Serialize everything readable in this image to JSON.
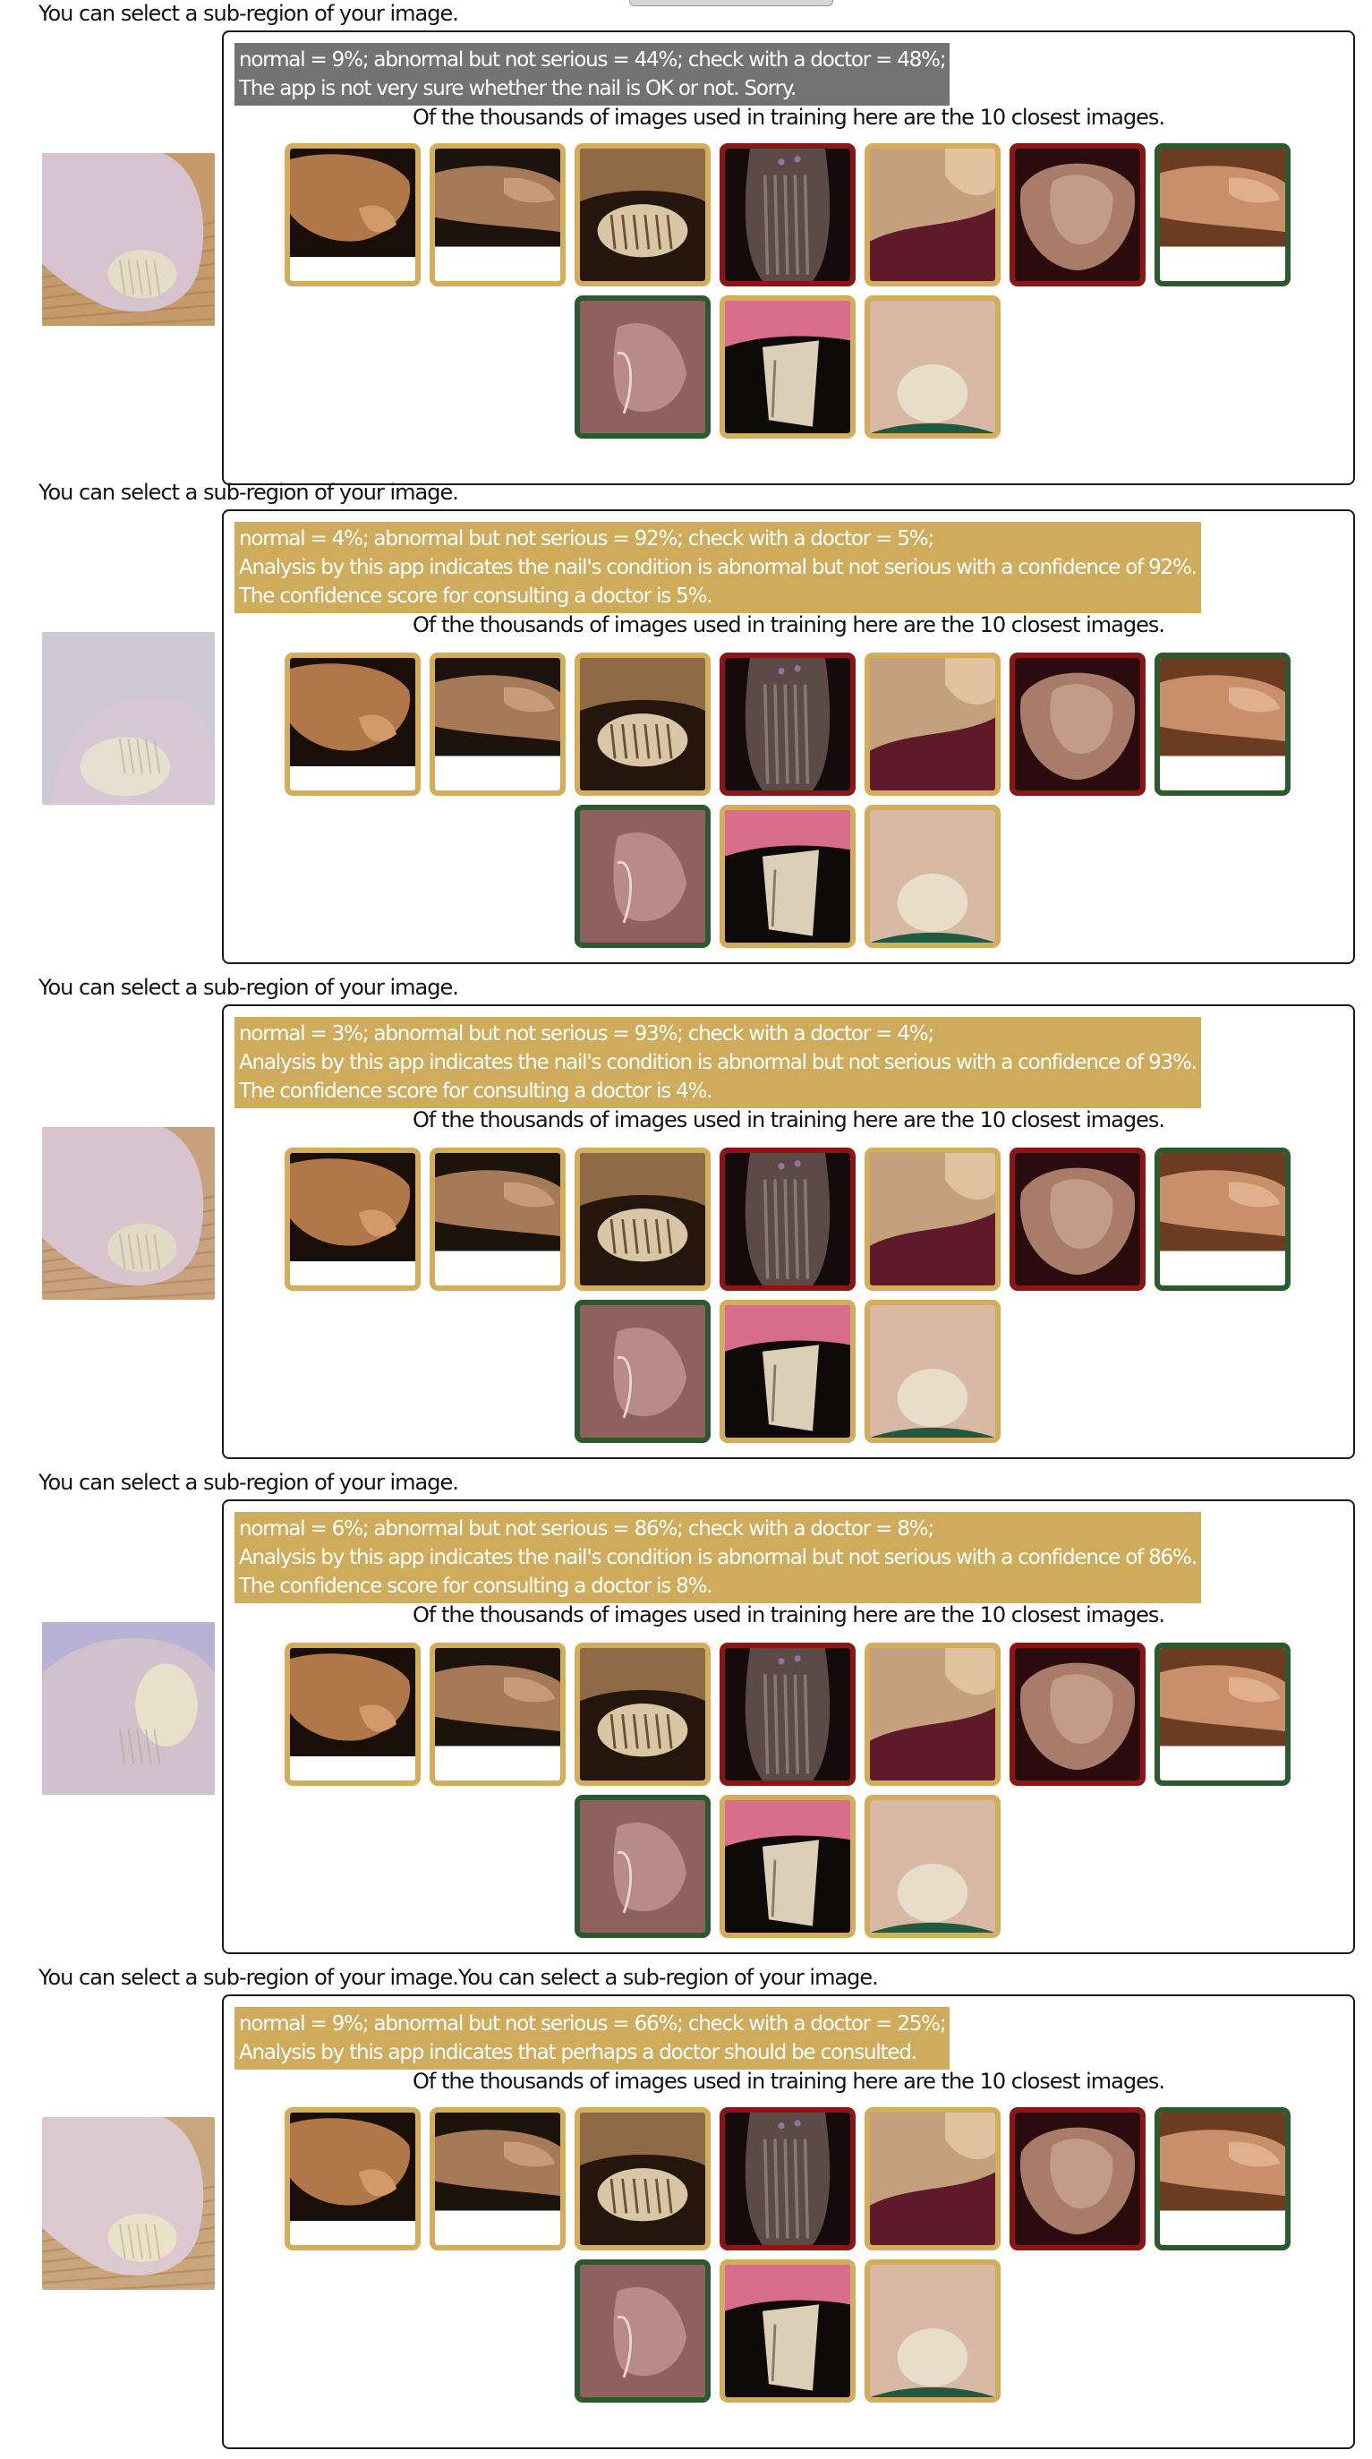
{
  "hint_text": "You can select a sub-region of your image.",
  "last_hint_text": "You can select a sub-region of your image.You can select a sub-region of your image.",
  "closest_caption": "Of the thousands of images used in training here are the 10 closest images.",
  "colors": {
    "not_sure_background": "#737373",
    "abnormal_not_serious": "#cfac5b",
    "abnormal_serious": "#8e1515",
    "normal": "#2b5a2e"
  },
  "results": [
    {
      "summary": "normal = 9%; abnormal but not serious = 44%; check with a doctor = 48%;",
      "verdict_lines": [
        "The app is not very sure whether the nail is OK or not. Sorry."
      ],
      "scores": {
        "normal": 9,
        "abnormal_not_serious": 44,
        "check_with_doctor": 48
      },
      "style": "grey"
    },
    {
      "summary": "normal = 4%; abnormal but not serious = 92%; check with a doctor = 5%;",
      "verdict_lines": [
        "Analysis by this app indicates the nail's condition is abnormal but not serious with a confidence of 92%.",
        "The confidence score for consulting a doctor is 5%."
      ],
      "scores": {
        "normal": 4,
        "abnormal_not_serious": 92,
        "check_with_doctor": 5
      },
      "style": "gold"
    },
    {
      "summary": "normal = 3%; abnormal but not serious = 93%; check with a doctor = 4%;",
      "verdict_lines": [
        "Analysis by this app indicates the nail's condition is abnormal but not serious with a confidence of 93%.",
        "The confidence score for consulting a doctor is 4%."
      ],
      "scores": {
        "normal": 3,
        "abnormal_not_serious": 93,
        "check_with_doctor": 4
      },
      "style": "gold"
    },
    {
      "summary": "normal = 6%; abnormal but not serious = 86%; check with a doctor = 8%;",
      "verdict_lines": [
        "Analysis by this app indicates the nail's condition is abnormal but not serious with a confidence of 86%.",
        "The confidence score for consulting a doctor is 8%."
      ],
      "scores": {
        "normal": 6,
        "abnormal_not_serious": 86,
        "check_with_doctor": 8
      },
      "style": "gold"
    },
    {
      "summary": "normal = 9%; abnormal but not serious = 66%; check with a doctor = 25%;",
      "verdict_lines": [
        "Analysis by this app indicates that perhaps a doctor should be consulted."
      ],
      "scores": {
        "normal": 9,
        "abnormal_not_serious": 66,
        "check_with_doctor": 25
      },
      "style": "gold"
    }
  ],
  "closest_images": [
    {
      "label_class": "abnormal_not_serious",
      "image": "toe-nail-yellowed"
    },
    {
      "label_class": "abnormal_not_serious",
      "image": "finger-side-dark"
    },
    {
      "label_class": "abnormal_not_serious",
      "image": "toe-nail-crumbly"
    },
    {
      "label_class": "abnormal_serious",
      "image": "nail-dark-streaked"
    },
    {
      "label_class": "abnormal_not_serious",
      "image": "knuckles-red-fabric"
    },
    {
      "label_class": "abnormal_serious",
      "image": "thumbnail-dark"
    },
    {
      "label_class": "normal",
      "image": "fingernail-tan"
    },
    {
      "label_class": "normal",
      "image": "finger-pink-closeup"
    },
    {
      "label_class": "abnormal_not_serious",
      "image": "nail-lifted-red"
    },
    {
      "label_class": "abnormal_not_serious",
      "image": "toenail-pale-green-bg"
    }
  ]
}
